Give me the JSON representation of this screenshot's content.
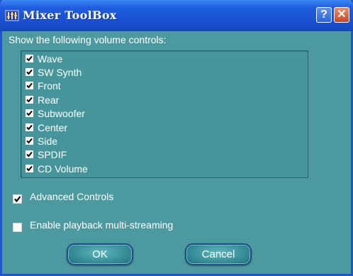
{
  "window": {
    "title": "Mixer ToolBox",
    "help_label": "?",
    "close_label": "✕"
  },
  "prompt": "Show the following volume controls:",
  "controls": [
    {
      "label": "Wave",
      "checked": true
    },
    {
      "label": "SW Synth",
      "checked": true
    },
    {
      "label": "Front",
      "checked": true
    },
    {
      "label": "Rear",
      "checked": true
    },
    {
      "label": "Subwoofer",
      "checked": true
    },
    {
      "label": "Center",
      "checked": true
    },
    {
      "label": "Side",
      "checked": true
    },
    {
      "label": "SPDIF",
      "checked": true
    },
    {
      "label": "CD Volume",
      "checked": true
    }
  ],
  "options": {
    "advanced_controls": {
      "label": "Advanced Controls",
      "checked": true
    },
    "multi_streaming": {
      "label": "Enable playback multi-streaming",
      "checked": false
    }
  },
  "buttons": {
    "ok": "OK",
    "cancel": "Cancel"
  },
  "colors": {
    "window_bg": "#4c9aa0",
    "titlebar": "#1f5de0",
    "text": "#ffffff"
  }
}
